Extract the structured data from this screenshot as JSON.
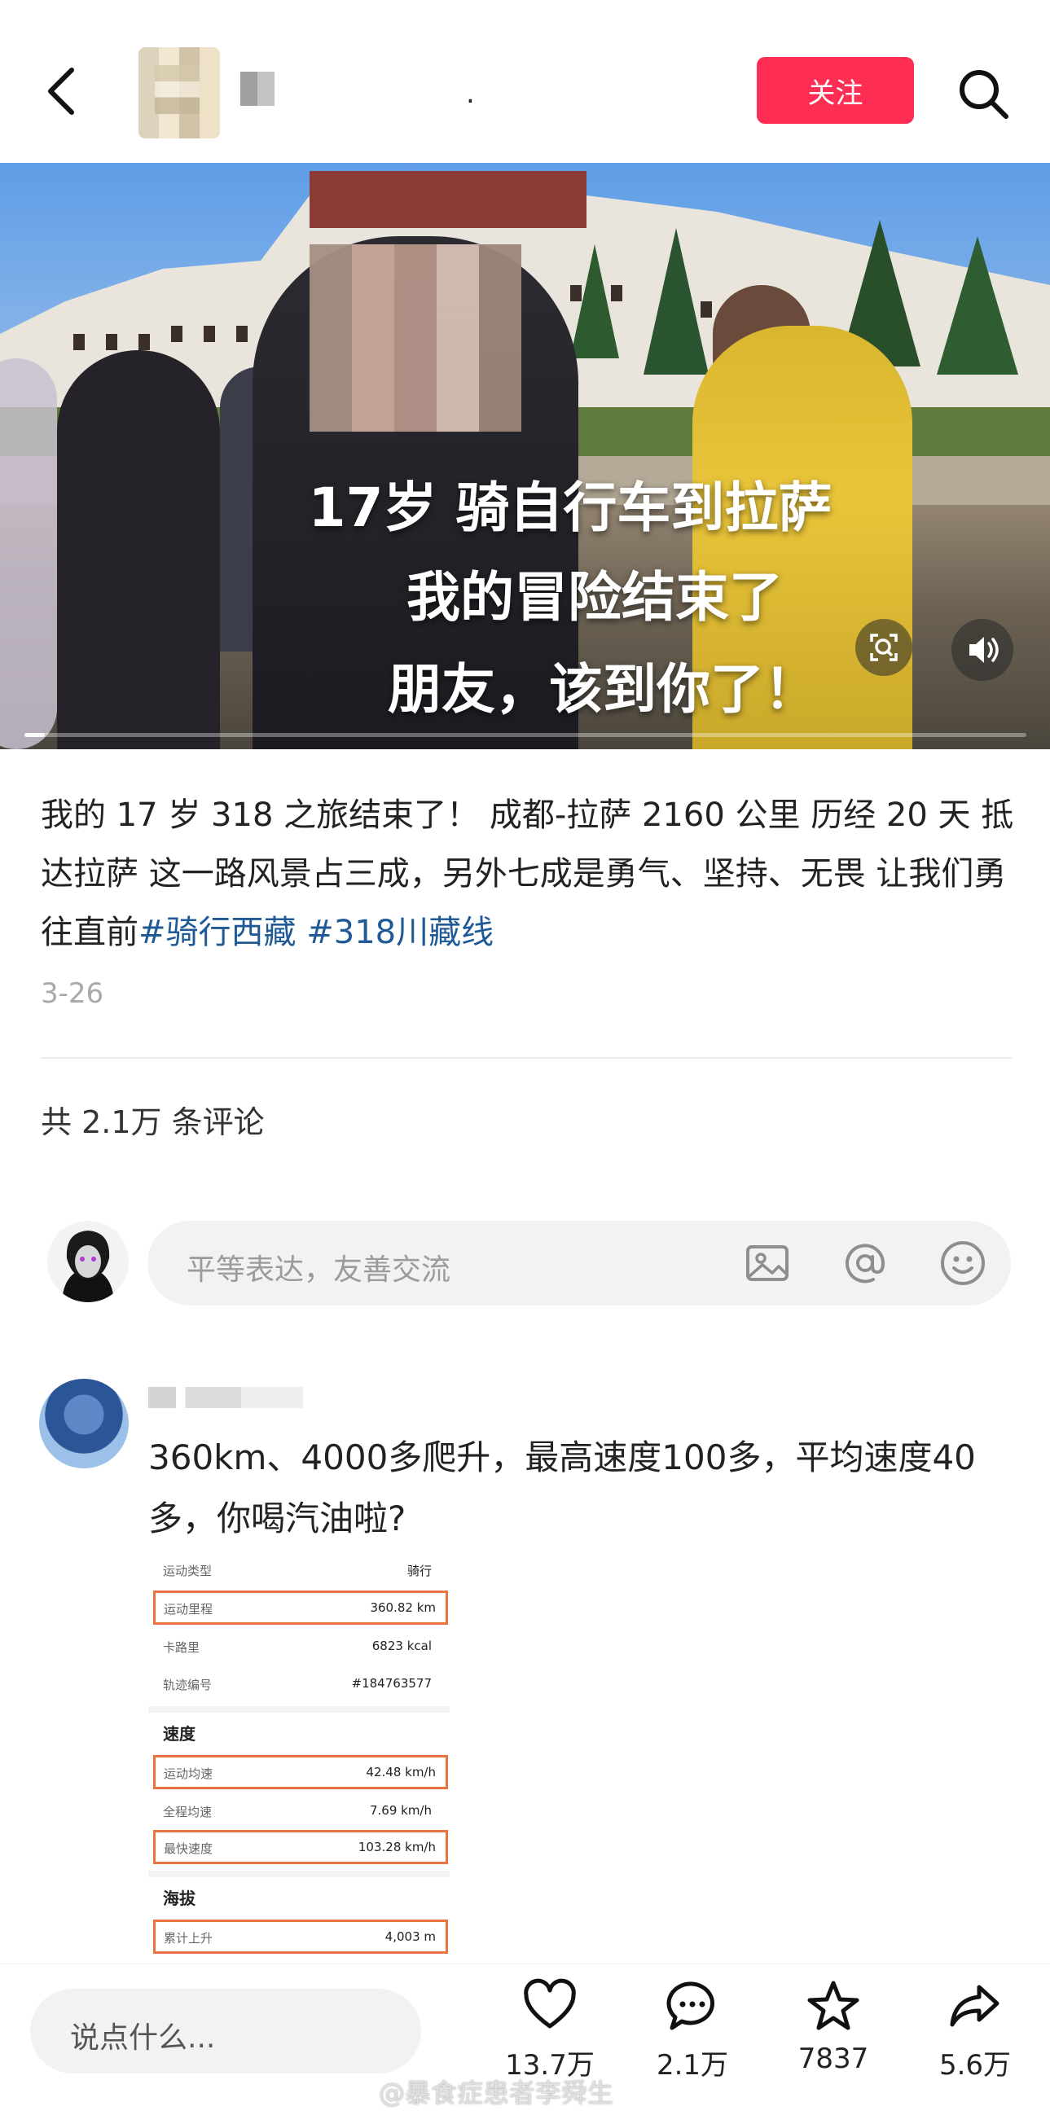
{
  "header": {
    "title_dot": ".",
    "follow_label": "关注"
  },
  "video": {
    "caption_lines": [
      "17岁 骑自行车到拉萨",
      "我的冒险结束了",
      "朋友，该到你了！"
    ],
    "progress": 0.02
  },
  "post": {
    "desc_text": "我的 17 岁 318 之旅结束了！ 成都-拉萨 2160 公里 历经 20 天 抵达拉萨 这一路风景占三成，另外七成是勇气、坚持、无畏 让我们勇往直前",
    "tags": [
      "#骑行西藏",
      "#318川藏线"
    ],
    "date": "3-26"
  },
  "comments": {
    "count_text": "共 2.1万 条评论",
    "input_placeholder": "平等表达，友善交流",
    "items": [
      {
        "text": "360km、4000多爬升，最高速度100多，平均速度40多，你喝汽油啦?",
        "screenshot": {
          "rows": [
            {
              "k": "运动类型",
              "v": "骑行"
            },
            {
              "k": "运动里程",
              "v": "360.82 km"
            },
            {
              "k": "卡路里",
              "v": "6823 kcal"
            },
            {
              "k": "轨迹编号",
              "v": "#184763577"
            }
          ],
          "section_speed": "速度",
          "speed_rows": [
            {
              "k": "运动均速",
              "v": "42.48 km/h"
            },
            {
              "k": "全程均速",
              "v": "7.69 km/h"
            },
            {
              "k": "最快速度",
              "v": "103.28 km/h"
            }
          ],
          "section_alt": "海拔",
          "alt_rows": [
            {
              "k": "累计上升",
              "v": "4,003 m"
            }
          ]
        }
      }
    ]
  },
  "bottom_bar": {
    "say_placeholder": "说点什么...",
    "like_count": "13.7万",
    "comment_count": "2.1万",
    "fav_count": "7837",
    "share_count": "5.6万",
    "watermark": "@暴食症患者李舜生"
  },
  "colors": {
    "follow_button": "#fd2d54",
    "hashtag": "#1f5a96",
    "highlight_box": "#e9743f"
  },
  "icons": [
    "back-icon",
    "search-icon",
    "zoom-icon",
    "sound-icon",
    "image-icon",
    "at-icon",
    "emoji-icon",
    "heart-icon",
    "comment-icon",
    "star-icon",
    "share-icon"
  ]
}
